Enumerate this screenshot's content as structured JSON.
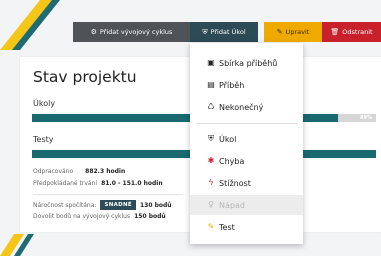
{
  "toolbar": {
    "add_cycle_label": "Přidat vývojový cyklus",
    "add_task_label": "Přidat Úkol",
    "edit_label": "Upravit",
    "delete_label": "Odstranit"
  },
  "project": {
    "title": "Stav projektu",
    "tasks_label": "Úkoly",
    "tasks_progress": 0.89,
    "tasks_progress_text": "89%",
    "tests_label": "Testy",
    "tests_progress": 1.0,
    "worked_label": "Odpracováno",
    "worked_value": "882.3 hodin",
    "expected_label": "Předpokládané trvání",
    "expected_value": "81.0 - 151.0 hodin",
    "difficulty_label": "Náročnost spočítána:",
    "difficulty_badge": "SNADNÉ",
    "difficulty_points": "130 bodů",
    "cycle_label": "Dovolit bodů na vývojový cyklus",
    "cycle_value": "150 bodů"
  },
  "dropdown": {
    "items": [
      {
        "label": "Sbírka příběhů",
        "icon": "collection-icon"
      },
      {
        "label": "Příběh",
        "icon": "story-icon"
      },
      {
        "label": "Nekonečný",
        "icon": "infinite-icon"
      },
      {
        "label": "Úkol",
        "icon": "task-icon"
      },
      {
        "label": "Chyba",
        "icon": "bug-icon"
      },
      {
        "label": "Stížnost",
        "icon": "complaint-icon"
      },
      {
        "label": "Nápad",
        "icon": "idea-icon",
        "disabled": true
      },
      {
        "label": "Test",
        "icon": "test-icon"
      }
    ]
  },
  "colors": {
    "accent": "#2d4a57",
    "progress": "#186a6e",
    "edit": "#efaa00",
    "delete": "#c9212c",
    "stripe_yellow": "#f5c518",
    "stripe_teal": "#1f6b74"
  }
}
